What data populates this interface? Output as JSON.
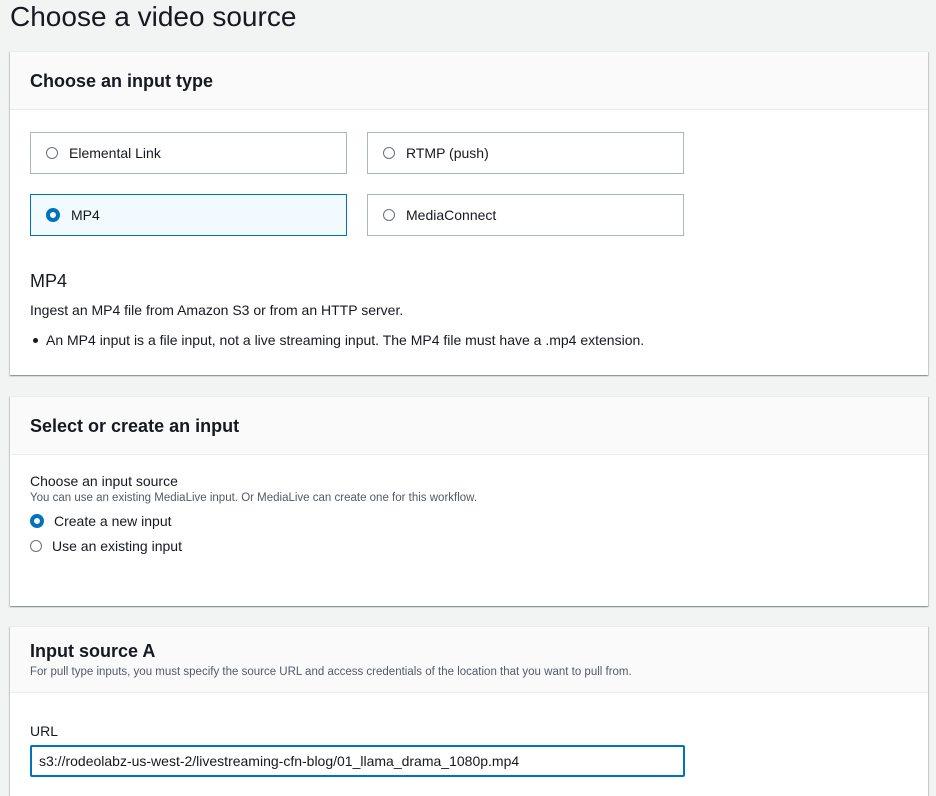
{
  "page": {
    "title": "Choose a video source"
  },
  "input_type_panel": {
    "title": "Choose an input type",
    "options": [
      {
        "label": "Elemental Link",
        "selected": false
      },
      {
        "label": "RTMP (push)",
        "selected": false
      },
      {
        "label": "MP4",
        "selected": true
      },
      {
        "label": "MediaConnect",
        "selected": false
      }
    ],
    "description": {
      "title": "MP4",
      "text": "Ingest an MP4 file from Amazon S3 or from an HTTP server.",
      "bullet": "An MP4 input is a file input, not a live streaming input. The MP4 file must have a .mp4 extension."
    }
  },
  "select_input_panel": {
    "title": "Select or create an input",
    "field_label": "Choose an input source",
    "field_description": "You can use an existing MediaLive input. Or MediaLive can create one for this workflow.",
    "options": [
      {
        "label": "Create a new input",
        "selected": true
      },
      {
        "label": "Use an existing input",
        "selected": false
      }
    ]
  },
  "source_a_panel": {
    "title": "Input source A",
    "subtitle": "For pull type inputs, you must specify the source URL and access credentials of the location that you want to pull from.",
    "url_label": "URL",
    "url_value": "s3://rodeolabz-us-west-2/livestreaming-cfn-blog/01_llama_drama_1080p.mp4"
  },
  "colors": {
    "accent": "#0073bb",
    "selected_tile_bg": "#f1faff",
    "page_bg": "#f2f3f3"
  }
}
